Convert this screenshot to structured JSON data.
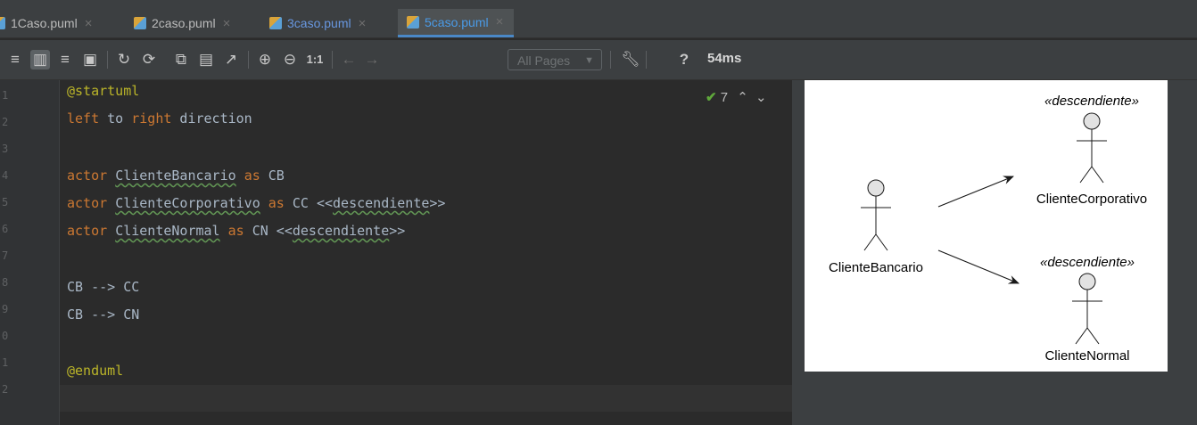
{
  "tabs": [
    {
      "label": "1Caso.puml"
    },
    {
      "label": "2caso.puml"
    },
    {
      "label": "3caso.puml"
    },
    {
      "label": "5caso.puml"
    }
  ],
  "toolbar": {
    "one_to_one": "1:1",
    "pages_label": "All Pages",
    "help": "?",
    "render_time": "54ms"
  },
  "editor": {
    "inspection_count": "7",
    "line_numbers": [
      "1",
      "2",
      "3",
      "4",
      "5",
      "6",
      "7",
      "8",
      "9",
      "0",
      "1",
      "2"
    ],
    "lines": [
      "@startuml",
      "left to right direction",
      "",
      "actor ClienteBancario as CB",
      "actor ClienteCorporativo as CC <<descendiente>>",
      "actor ClienteNormal as CN <<descendiente>>",
      "",
      "CB --> CC",
      "CB --> CN",
      "",
      "@enduml",
      ""
    ]
  },
  "diagram": {
    "actors": [
      {
        "name": "ClienteBancario",
        "stereotype": ""
      },
      {
        "name": "ClienteCorporativo",
        "stereotype": "«descendiente»"
      },
      {
        "name": "ClienteNormal",
        "stereotype": "«descendiente»"
      }
    ]
  }
}
